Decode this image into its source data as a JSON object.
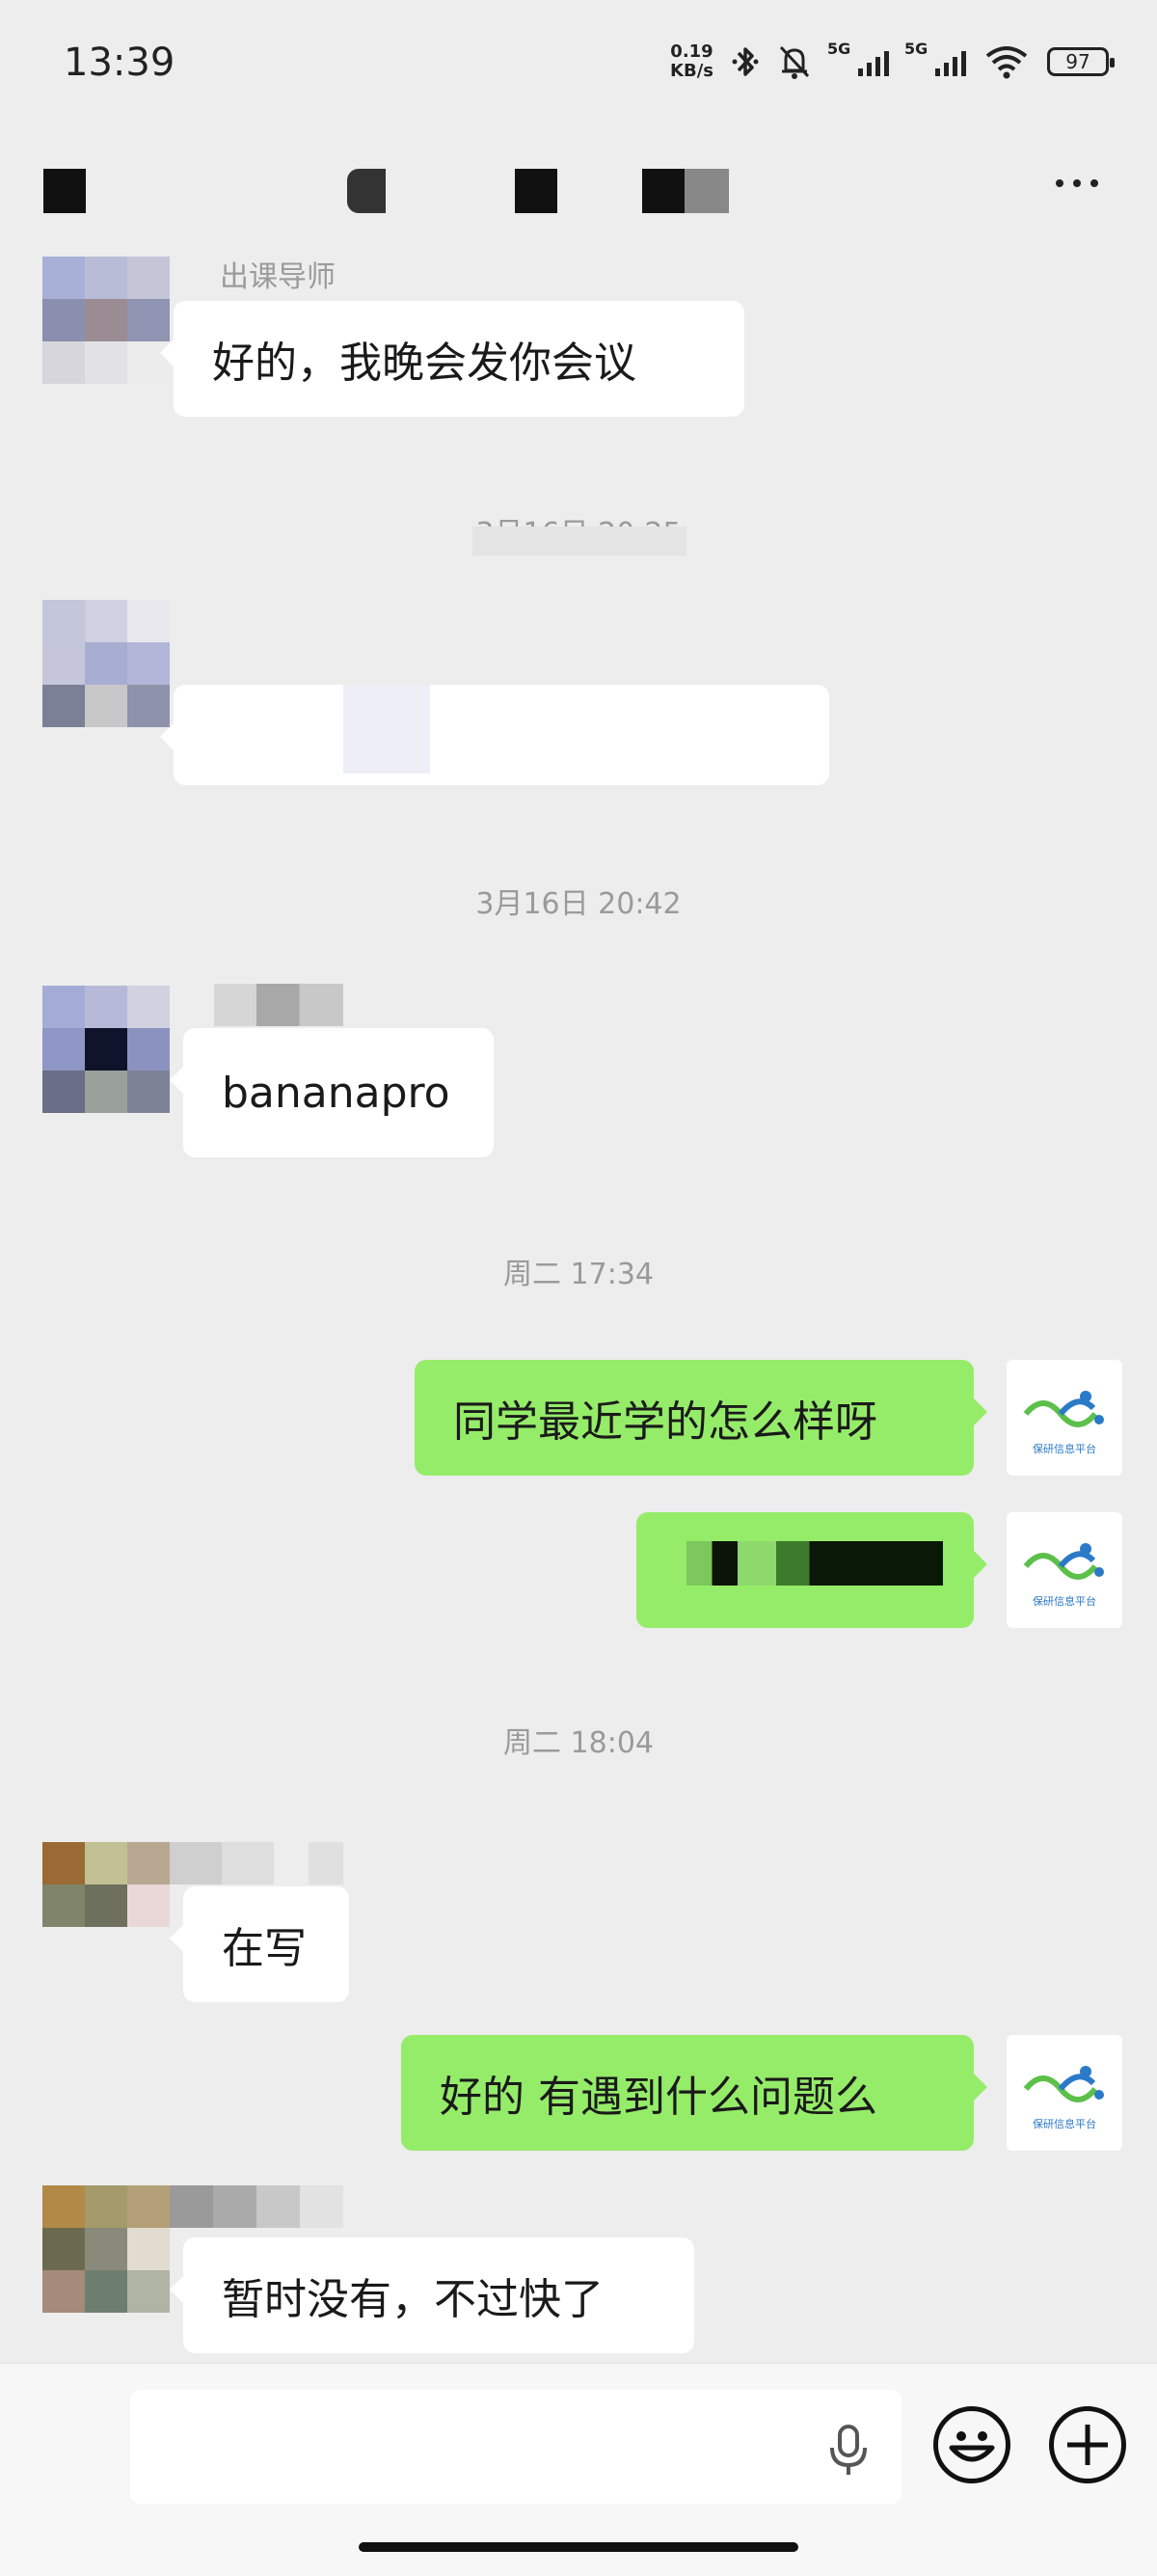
{
  "status_bar": {
    "time": "13:39",
    "net_speed_value": "0.19",
    "net_speed_unit": "KB/s",
    "signal1_label": "5G",
    "signal2_label": "5G",
    "battery": "97",
    "icons": [
      "bluetooth-icon",
      "mute-bell-icon",
      "signal-icon",
      "wifi-icon",
      "battery-icon"
    ]
  },
  "header": {
    "title": "",
    "more_icon": "more-dots-icon"
  },
  "messages": [
    {
      "type": "incoming",
      "sender": "出课导师",
      "text": "好的，我晚会发你会议"
    },
    {
      "type": "timestamp",
      "text": "3月16日 20:25"
    },
    {
      "type": "incoming",
      "sender": "",
      "text": ""
    },
    {
      "type": "timestamp",
      "text": "3月16日 20:42"
    },
    {
      "type": "incoming",
      "sender": "",
      "text": "bananapro"
    },
    {
      "type": "timestamp",
      "text": "周二 17:34"
    },
    {
      "type": "outgoing",
      "text": "同学最近学的怎么样呀"
    },
    {
      "type": "outgoing",
      "text": ""
    },
    {
      "type": "timestamp",
      "text": "周二 18:04"
    },
    {
      "type": "incoming",
      "sender": "",
      "text": "在写"
    },
    {
      "type": "outgoing",
      "text": "好的 有遇到什么问题么"
    },
    {
      "type": "incoming",
      "sender": "",
      "text": "暂时没有，不过快了"
    }
  ],
  "self_avatar_caption": "保研信息平台",
  "input": {
    "placeholder": "",
    "voice_icon": "microphone-icon",
    "emoji_icon": "emoji-icon",
    "plus_icon": "plus-icon"
  },
  "colors": {
    "background": "#ededed",
    "outgoing_bubble": "#95ec69",
    "incoming_bubble": "#ffffff",
    "timestamp": "#9a9a9a"
  }
}
